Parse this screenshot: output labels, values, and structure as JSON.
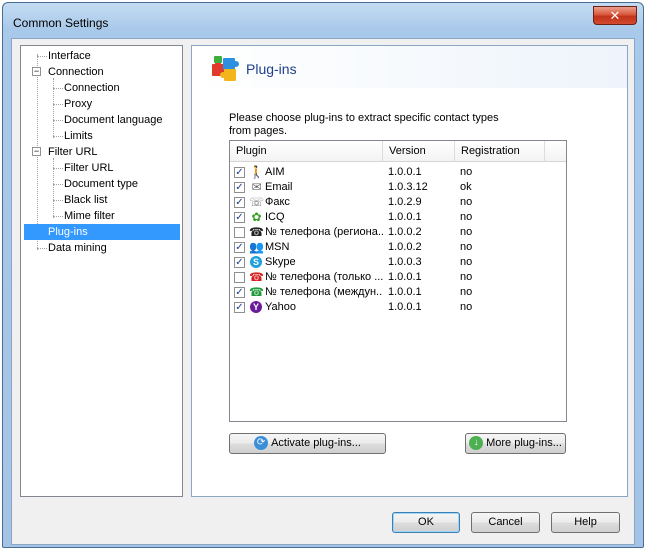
{
  "window": {
    "title": "Common Settings",
    "close_glyph": "✕"
  },
  "tree": {
    "items": [
      {
        "label": "Interface"
      },
      {
        "label": "Connection",
        "expander": "⊟"
      },
      {
        "label": "Connection"
      },
      {
        "label": "Proxy"
      },
      {
        "label": "Document language"
      },
      {
        "label": "Limits"
      },
      {
        "label": "Filter URL",
        "expander": "⊟"
      },
      {
        "label": "Filter URL"
      },
      {
        "label": "Document type"
      },
      {
        "label": "Black list"
      },
      {
        "label": "Mime filter"
      },
      {
        "label": "Plug-ins"
      },
      {
        "label": "Data mining"
      }
    ]
  },
  "panel": {
    "title": "Plug-ins",
    "icon": "puzzle-icon",
    "description_line1": "Please choose plug-ins to extract specific contact types",
    "description_line2": "from pages."
  },
  "list": {
    "columns": [
      "Plugin",
      "Version",
      "Registration"
    ],
    "rows": [
      {
        "checked": "✓",
        "icon": "aim-icon",
        "name": "AIM",
        "version": "1.0.0.1",
        "registration": "no"
      },
      {
        "checked": "✓",
        "icon": "email-icon",
        "name": "Email",
        "version": "1.0.3.12",
        "registration": "ok"
      },
      {
        "checked": "✓",
        "icon": "fax-icon",
        "name": "Факс",
        "version": "1.0.2.9",
        "registration": "no"
      },
      {
        "checked": "✓",
        "icon": "icq-icon",
        "name": "ICQ",
        "version": "1.0.0.1",
        "registration": "no"
      },
      {
        "checked": "",
        "icon": "phone-icon",
        "name": "№ телефона (региона...",
        "version": "1.0.0.2",
        "registration": "no"
      },
      {
        "checked": "✓",
        "icon": "msn-icon",
        "name": "MSN",
        "version": "1.0.0.2",
        "registration": "no"
      },
      {
        "checked": "✓",
        "icon": "skype-icon",
        "name": "Skype",
        "version": "1.0.0.3",
        "registration": "no"
      },
      {
        "checked": "",
        "icon": "phone-icon",
        "name": "№ телефона (только ...",
        "version": "1.0.0.1",
        "registration": "no"
      },
      {
        "checked": "✓",
        "icon": "phone-icon",
        "name": "№ телефона (междун...",
        "version": "1.0.0.1",
        "registration": "no"
      },
      {
        "checked": "✓",
        "icon": "yahoo-icon",
        "name": "Yahoo",
        "version": "1.0.0.1",
        "registration": "no"
      }
    ]
  },
  "buttons": {
    "activate": "Activate plug-ins...",
    "more": "More plug-ins...",
    "ok": "OK",
    "cancel": "Cancel",
    "help": "Help"
  },
  "colors": {
    "selection": "#3399ff",
    "header_text": "#1e3f8c"
  }
}
